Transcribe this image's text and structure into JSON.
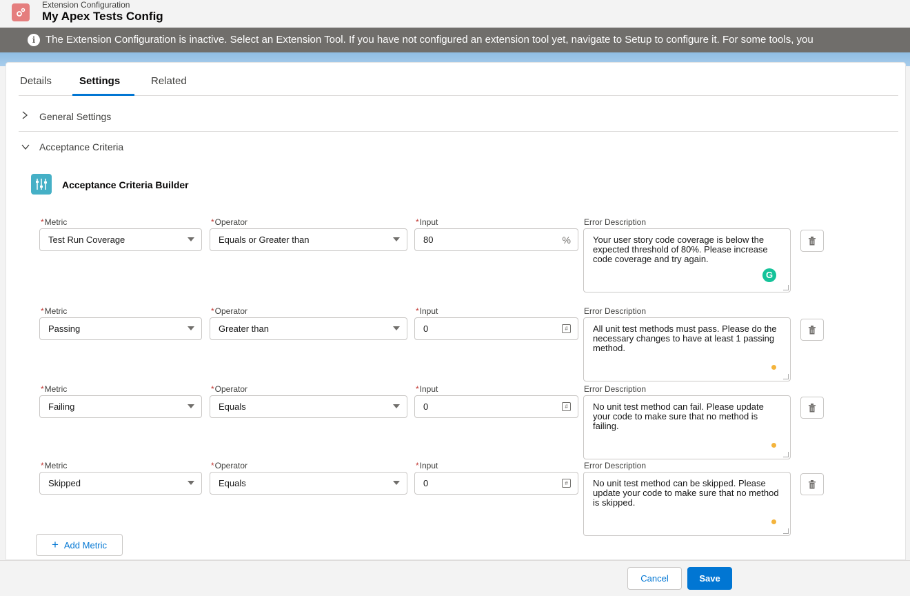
{
  "header": {
    "subtitle": "Extension Configuration",
    "title": "My Apex Tests Config",
    "icon": "gears-icon"
  },
  "banner": {
    "icon": "info-icon",
    "text": "The Extension Configuration is inactive. Select an Extension Tool. If you have not configured an extension tool yet, navigate to Setup to configure it. For some tools, you"
  },
  "tabs": [
    "Details",
    "Settings",
    "Related"
  ],
  "active_tab": "Settings",
  "sections": {
    "general": "General Settings",
    "acceptance": "Acceptance Criteria"
  },
  "builder": {
    "title": "Acceptance Criteria Builder",
    "labels": {
      "metric": "Metric",
      "operator": "Operator",
      "input": "Input",
      "error": "Error Description",
      "required_mark": "*"
    },
    "rows": [
      {
        "metric": "Test Run Coverage",
        "operator": "Equals or Greater than",
        "input": "80",
        "input_suffix": "%",
        "error": "Your user story code coverage is below the expected threshold of 80%. Please increase code coverage and try again."
      },
      {
        "metric": "Passing",
        "operator": "Greater than",
        "input": "0",
        "input_suffix": "#",
        "error": "All unit test methods must pass. Please do the necessary changes to have at least 1 passing method."
      },
      {
        "metric": "Failing",
        "operator": "Equals",
        "input": "0",
        "input_suffix": "#",
        "error": "No unit test method can fail. Please update your code to make sure that no method is failing."
      },
      {
        "metric": "Skipped",
        "operator": "Equals",
        "input": "0",
        "input_suffix": "#",
        "error": "No unit test method can be skipped. Please update your code to make sure that no method is skipped."
      }
    ],
    "add_label": "Add Metric"
  },
  "footer": {
    "cancel": "Cancel",
    "save": "Save"
  },
  "colors": {
    "brand_blue": "#0176d3",
    "banner_gray": "#706e6b",
    "header_icon": "#e57e7e",
    "builder_icon": "#45b0c6"
  }
}
